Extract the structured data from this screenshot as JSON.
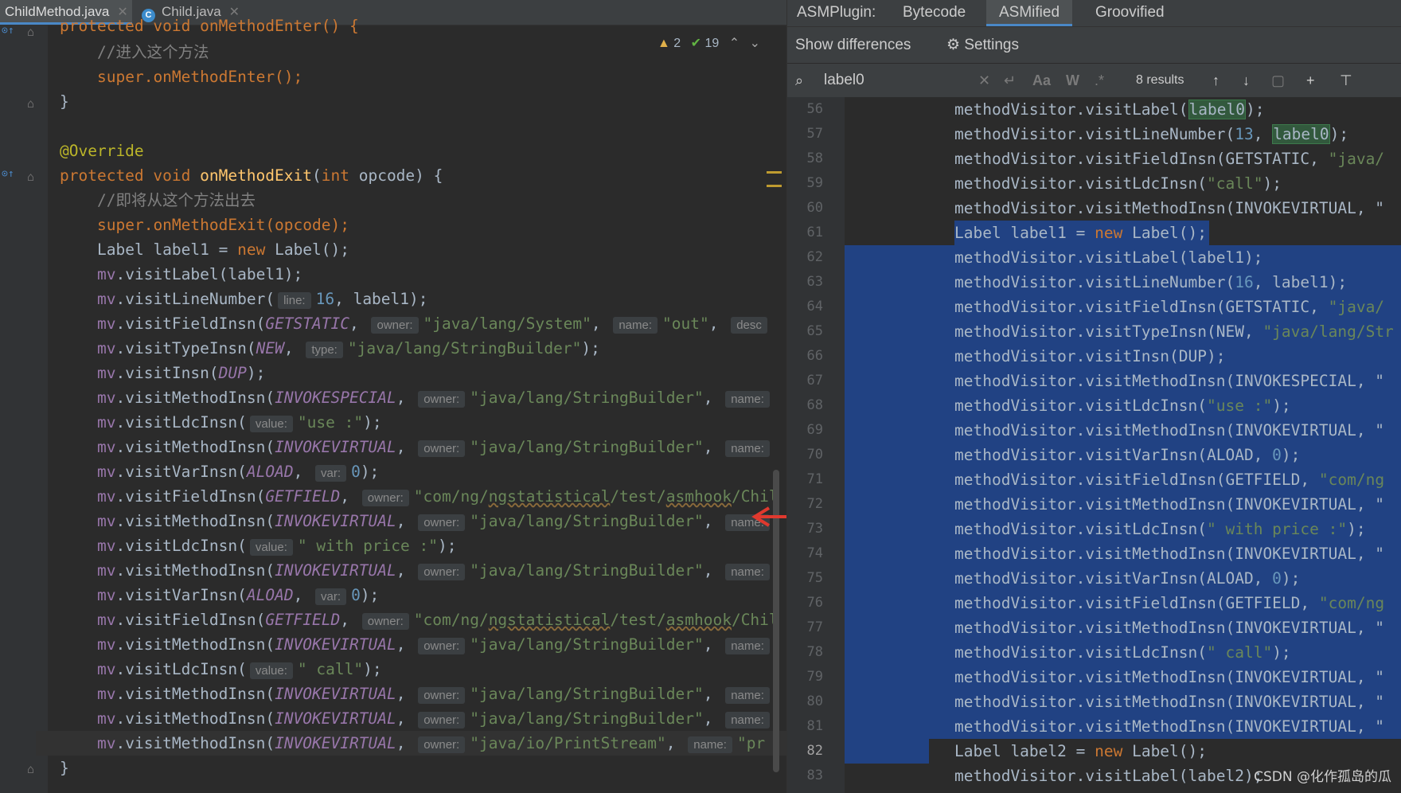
{
  "editor_tabs": [
    {
      "label": "ChildMethod.java",
      "active": true
    },
    {
      "label": "Child.java",
      "active": false
    }
  ],
  "inspection": {
    "warnings": "2",
    "typos": "19"
  },
  "left_code": {
    "l0": "protected void onMethodEnter() {",
    "l1": "//进入这个方法",
    "l2": "super.onMethodEnter();",
    "l3": "}",
    "l5": "@Override",
    "l6_a": "protected void ",
    "l6_b": "onMethodExit",
    "l6_c": "(",
    "l6_d": "int",
    "l6_e": " opcode) {",
    "l7": "//即将从这个方法出去",
    "l8": "super.onMethodExit(opcode);",
    "l9_a": "Label label1 = ",
    "l9_b": "new",
    "l9_c": " Label();",
    "mv": "mv",
    "hint_line": "line:",
    "hint_owner": "owner:",
    "hint_name": "name:",
    "hint_desc": "desc",
    "hint_type": "type:",
    "hint_value": "value:",
    "hint_var": "var:",
    "visitLabel": ".visitLabel(label1);",
    "visitLineNumber": ".visitLineNumber(",
    "n16": "16",
    "label1end": ", label1);",
    "visitFieldInsn": ".visitFieldInsn(",
    "GETSTATIC": "GETSTATIC",
    "GETFIELD": "GETFIELD",
    "s_system": "\"java/lang/System\"",
    "s_out": "\"out\"",
    "visitTypeInsn": ".visitTypeInsn(",
    "NEW": "NEW",
    "s_sb": "\"java/lang/StringBuilder\"",
    "visitInsn": ".visitInsn(",
    "DUP": "DUP",
    "visitMethodInsn": ".visitMethodInsn(",
    "INVOKESPECIAL": "INVOKESPECIAL",
    "INVOKEVIRTUAL": "INVOKEVIRTUAL",
    "visitLdcInsn": ".visitLdcInsn(",
    "s_use": "\"use :\"",
    "s_price": "\" with price :\"",
    "s_call": "\" call\"",
    "visitVarInsn": ".visitVarInsn(",
    "ALOAD": "ALOAD",
    "n0": "0",
    "s_chi_a": "\"com/ng/",
    "s_chi_b": "ngstatistical",
    "s_chi_c": "/test/",
    "s_chi_d": "asmhook",
    "s_chi_e": "/Chil",
    "s_ps": "\"java/io/PrintStream\"",
    "s_pr": "\"pr",
    "close": "}"
  },
  "panel_tabs": {
    "plugin": "ASMPlugin:",
    "bytecode": "Bytecode",
    "asmified": "ASMified",
    "groovified": "Groovified"
  },
  "panel_toolbar": {
    "show_diff": "Show differences",
    "settings": "Settings"
  },
  "search": {
    "value": "label0",
    "results": "8 results"
  },
  "right_lines": [
    "56",
    "57",
    "58",
    "59",
    "60",
    "61",
    "62",
    "63",
    "64",
    "65",
    "66",
    "67",
    "68",
    "69",
    "70",
    "71",
    "72",
    "73",
    "74",
    "75",
    "76",
    "77",
    "78",
    "79",
    "80",
    "81",
    "82",
    "83"
  ],
  "right_code": {
    "mv": "methodVisitor",
    "visitLabel": ".visitLabel(",
    "label0": "label0",
    "visitLineNumber": ".visitLineNumber(",
    "n13": "13",
    "n16": "16",
    "visitFieldInsn": ".visitFieldInsn(GETSTATIC, ",
    "s_java": "\"java/",
    "visitLdc_call": "\"call\"",
    "visitMethodInsn_virt": ".visitMethodInsn(INVOKEVIRTUAL, \"",
    "visitMethodInsn_spec": ".visitMethodInsn(INVOKESPECIAL, \"",
    "label1decl_a": "Label label1 = ",
    "new": "new",
    "label1decl_c": " Label();",
    "label2decl_a": "Label label2 = ",
    "label2decl_c": " Label();",
    "visitLabel_l1": ".visitLabel(label1);",
    "lineNum16_end": ", label1);",
    "visitTypeInsn": ".visitTypeInsn(NEW, ",
    "s_javaLangStr": "\"java/lang/Str",
    "visitInsn": ".visitInsn(DUP);",
    "visitLdcInsn": ".visitLdcInsn(",
    "s_use": "\"use :\"",
    "s_price": "\" with price :\"",
    "s_call": "\" call\"",
    "visitVarInsn": ".visitVarInsn(ALOAD, ",
    "n0": "0",
    "visitFieldGet": ".visitFieldInsn(GETFIELD, ",
    "s_comng": "\"com/ng",
    "visitLabel2": ".visitLabel(labe",
    "l2tail": "l2);"
  },
  "watermark": "CSDN @化作孤岛的瓜"
}
